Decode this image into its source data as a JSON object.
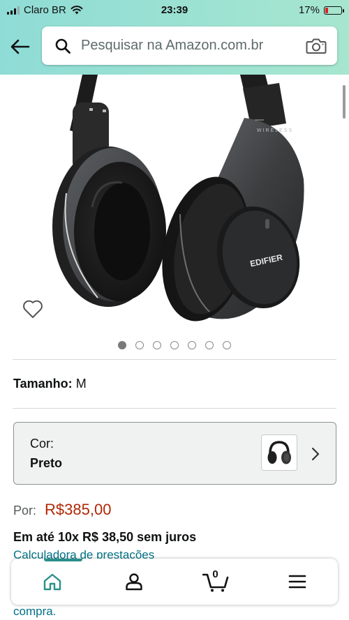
{
  "status_bar": {
    "carrier": "Claro BR",
    "time": "23:39",
    "battery_percent": "17%",
    "battery_level": 0.17
  },
  "header": {
    "search_placeholder": "Pesquisar na Amazon.com.br"
  },
  "product": {
    "brand_mark": "EDIFIER",
    "image_pager": {
      "count": 7,
      "active_index": 0
    },
    "size_label": "Tamanho:",
    "size_value": "M",
    "color_label": "Cor:",
    "color_value": "Preto",
    "price_label": "Por:",
    "price_value": "R$385,00",
    "installments": "Em até 10x R$ 38,50 sem juros",
    "calculator_link": "Calculadora de prestações",
    "partial_link": "compra."
  },
  "bottom_nav": {
    "active": "home",
    "cart_count": "0"
  },
  "colors": {
    "header_start": "#8fdcd6",
    "header_end": "#a6e6cf",
    "price": "#b12704",
    "link": "#007185",
    "accent": "#2a8f8a"
  }
}
